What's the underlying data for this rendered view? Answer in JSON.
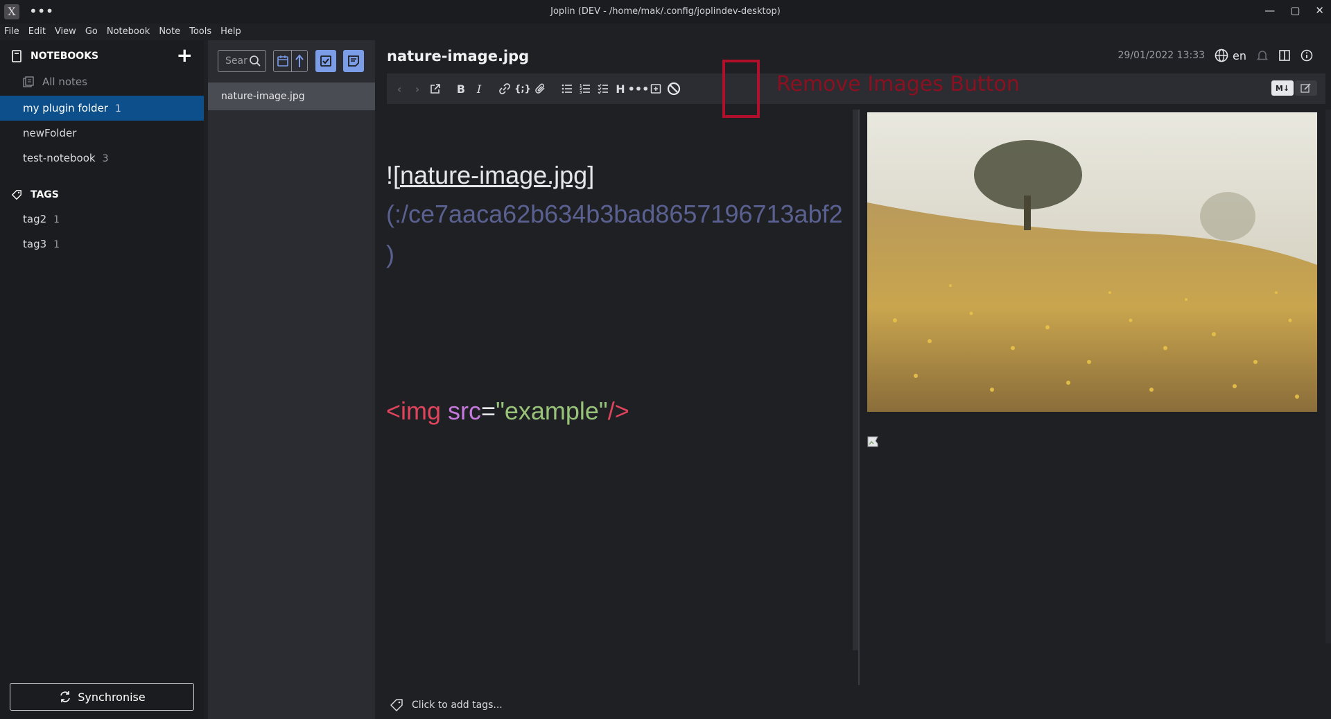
{
  "window": {
    "title": "Joplin (DEV - /home/mak/.config/joplindev-desktop)",
    "app_icon": "X",
    "more": "•••",
    "controls": [
      "—",
      "▢",
      "✕"
    ]
  },
  "menu": [
    "File",
    "Edit",
    "View",
    "Go",
    "Notebook",
    "Note",
    "Tools",
    "Help"
  ],
  "sidebar": {
    "notebooks_header": "NOTEBOOKS",
    "all_notes": "All notes",
    "notebooks": [
      {
        "label": "my plugin folder",
        "count": "1",
        "active": true
      },
      {
        "label": "newFolder",
        "count": ""
      },
      {
        "label": "test-notebook",
        "count": "3"
      }
    ],
    "tags_header": "TAGS",
    "tags": [
      {
        "label": "tag2",
        "count": "1"
      },
      {
        "label": "tag3",
        "count": "1"
      }
    ],
    "sync_label": "Synchronise"
  },
  "notelist": {
    "search_placeholder": "Sear",
    "items": [
      {
        "title": "nature-image.jpg"
      }
    ]
  },
  "editor": {
    "title": "nature-image.jpg",
    "date": "29/01/2022 13:33",
    "lang": "en",
    "code": {
      "bang": "!",
      "lbr": "[",
      "link_text": "nature-image.jpg",
      "rbr": "]",
      "url1": "(:/ce7aaca62b634b3bad8657196713abf2",
      "url2": ")",
      "tag_open": "<img",
      "attr": "src",
      "eq": "=",
      "str": "\"example\"",
      "tag_close": "/>"
    },
    "annotation": "Remove Images Button",
    "md_toggle": "M↓",
    "tags_prompt": "Click to add tags..."
  },
  "colors": {
    "accent": "#0c4f8a",
    "highlight": "#b1102d",
    "toolbar_active": "#7b9de8"
  }
}
